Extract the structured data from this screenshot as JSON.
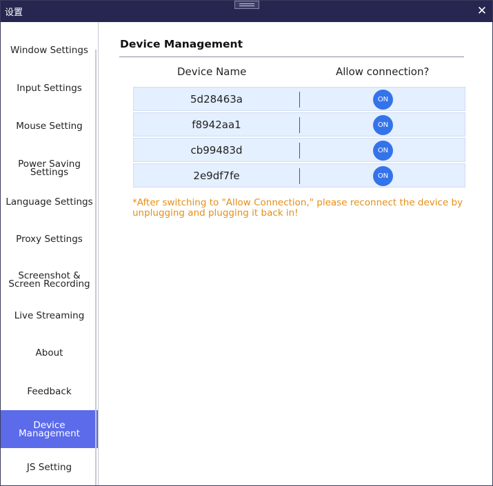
{
  "window": {
    "title": "设置",
    "close_glyph": "✕"
  },
  "sidebar": {
    "items": [
      {
        "label": "Window Settings"
      },
      {
        "label": "Input Settings"
      },
      {
        "label": "Mouse Setting"
      },
      {
        "label": "Power Saving Settings"
      },
      {
        "label": "Language Settings"
      },
      {
        "label": "Proxy Settings"
      },
      {
        "label": "Screenshot & Screen Recording"
      },
      {
        "label": "Live Streaming"
      },
      {
        "label": "About"
      },
      {
        "label": "Feedback"
      },
      {
        "label": "Device Management",
        "active": true
      },
      {
        "label": "JS Setting"
      }
    ]
  },
  "main": {
    "title": "Device Management",
    "columns": [
      "Device Name",
      "Allow connection?"
    ],
    "devices": [
      {
        "name": "5d28463a",
        "toggle": "ON"
      },
      {
        "name": "f8942aa1",
        "toggle": "ON"
      },
      {
        "name": "cb99483d",
        "toggle": "ON"
      },
      {
        "name": "2e9df7fe",
        "toggle": "ON"
      }
    ],
    "note": "*After switching to \"Allow Connection,\" please reconnect the device by unplugging and plugging it back in!"
  },
  "colors": {
    "titlebar": "#262651",
    "active_nav": "#5b6bea",
    "toggle_on": "#3473ea",
    "row_bg": "#e4efff",
    "note_text": "#e58e17"
  }
}
